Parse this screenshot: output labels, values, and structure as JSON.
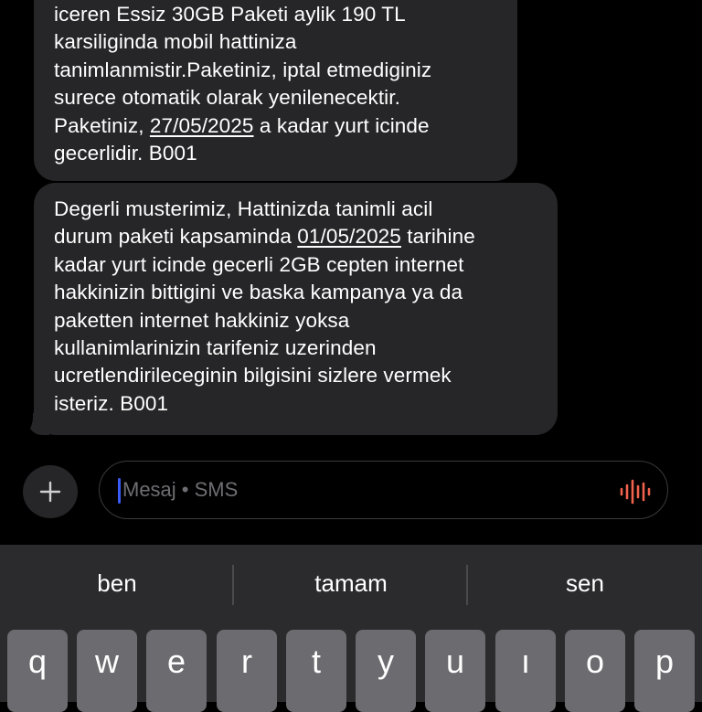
{
  "messages": [
    {
      "lines": [
        {
          "text": "iceren Essiz 30GB Paketi aylik 190 TL"
        },
        {
          "text": "karsiliginda mobil hattiniza"
        },
        {
          "text": "tanimlanmistir.Paketiniz, iptal etmediginiz"
        },
        {
          "text": "surece otomatik olarak yenilenecektir."
        },
        {
          "pre": "Paketiniz, ",
          "date": "27/05/2025",
          "post": " a kadar yurt icinde"
        },
        {
          "text": "gecerlidir. B001"
        }
      ]
    },
    {
      "lines": [
        {
          "text": "Degerli musterimiz, Hattinizda tanimli acil"
        },
        {
          "pre": "durum paketi kapsaminda ",
          "date": "01/05/2025",
          "post": " tarihine"
        },
        {
          "text": "kadar yurt icinde gecerli 2GB cepten internet"
        },
        {
          "text": "hakkinizin bittigini ve baska kampanya ya da"
        },
        {
          "text": "paketten internet hakkiniz yoksa"
        },
        {
          "text": "kullanimlarinizin tarifeniz uzerinden"
        },
        {
          "text": "ucretlendirileceginin bilgisini sizlere vermek"
        },
        {
          "text": "isteriz. B001"
        }
      ]
    }
  ],
  "composer": {
    "placeholder": "Mesaj • SMS",
    "plus_icon": "plus-icon",
    "voice_icon": "waveform-icon",
    "voice_color": "#f0624d",
    "caret_color": "#3b5bf5"
  },
  "keyboard": {
    "suggestions": [
      "ben",
      "tamam",
      "sen"
    ],
    "keys": [
      "q",
      "w",
      "e",
      "r",
      "t",
      "y",
      "u",
      "ı",
      "o",
      "p"
    ]
  }
}
